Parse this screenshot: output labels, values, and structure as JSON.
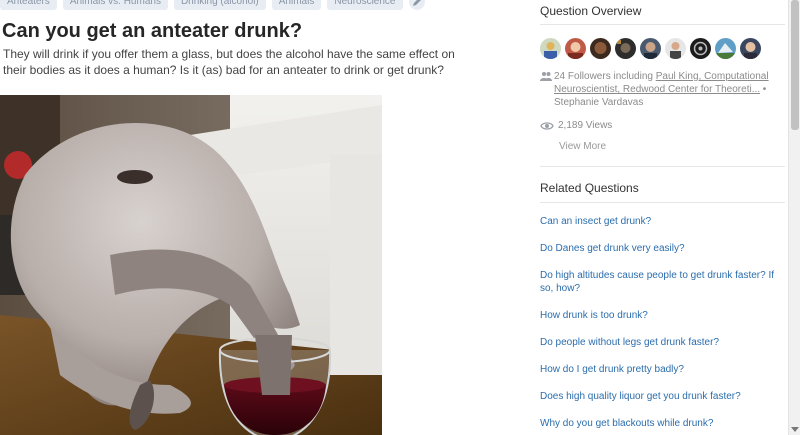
{
  "topics": [
    "Anteaters",
    "Animals vs. Humans",
    "Drinking (alcohol)",
    "Animals",
    "Neuroscience"
  ],
  "question": {
    "title": "Can you get an anteater drunk?",
    "detail": "They will drink if you offer them a glass, but does the alcohol have the same effect on their bodies as it does a human? Is it (as) bad for an anteater to drink or get drunk?"
  },
  "image": {
    "subject": "anteater drinking red wine from a glass"
  },
  "overview": {
    "title": "Question Overview",
    "avatars": [
      "avatar-1",
      "avatar-2",
      "avatar-3",
      "avatar-4",
      "avatar-5",
      "avatar-6",
      "avatar-7",
      "avatar-8",
      "avatar-9"
    ],
    "followers_prefix": "24 Followers including ",
    "follower_name_1": "Paul King, Computational Neuroscientist, Redwood Center for Theoreti...",
    "separator": " • ",
    "follower_name_2": "Stephanie Vardavas",
    "views": "2,189 Views",
    "view_more": "View More"
  },
  "related": {
    "title": "Related Questions",
    "questions": [
      "Can an insect get drunk?",
      "Do Danes get drunk very easily?",
      "Do high altitudes cause people to get drunk faster? If so, how?",
      "How drunk is too drunk?",
      "Do people without legs get drunk faster?",
      "How do I get drunk pretty badly?",
      "Does high quality liquor get you drunk faster?",
      "Why do you get blackouts while drunk?"
    ]
  },
  "colors": {
    "link": "#2b6dad",
    "muted": "#8b8b8b",
    "topic_bg": "#e8edf4"
  }
}
